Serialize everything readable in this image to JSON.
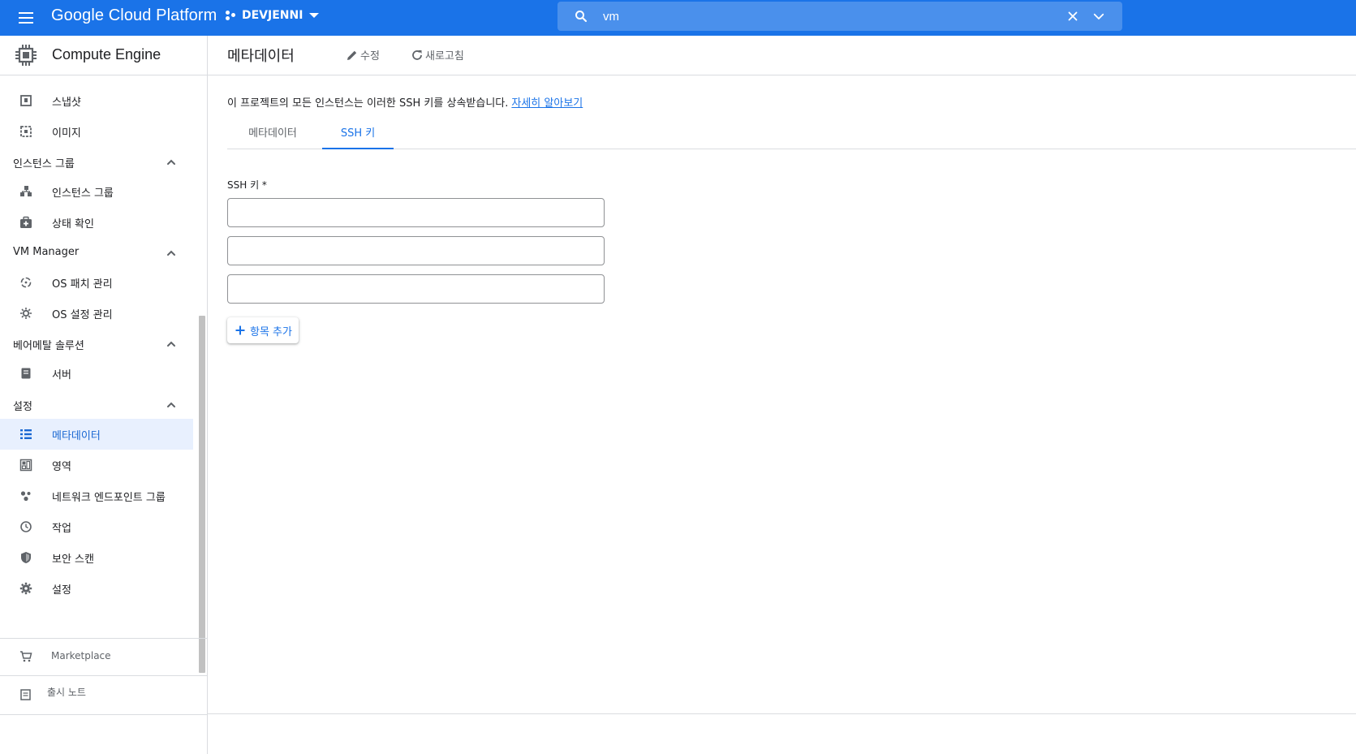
{
  "app": {
    "brand": "Google Cloud Platform",
    "project": "DEVJENNI"
  },
  "search": {
    "value": "vm"
  },
  "sidebar": {
    "product": "Compute Engine",
    "items": [
      {
        "label": "스냅샷",
        "icon": "snapshot-icon"
      },
      {
        "label": "이미지",
        "icon": "image-icon"
      }
    ],
    "groups": {
      "instance_groups": {
        "label": "인스턴스 그룹",
        "items": [
          {
            "label": "인스턴스 그룹",
            "icon": "instance-groups-icon"
          },
          {
            "label": "상태 확인",
            "icon": "health-check-icon"
          }
        ]
      },
      "vm_manager": {
        "label": "VM Manager",
        "items": [
          {
            "label": "OS 패치 관리",
            "icon": "os-patch-icon"
          },
          {
            "label": "OS 설정 관리",
            "icon": "os-config-icon"
          }
        ]
      },
      "bare_metal": {
        "label": "베어메탈 솔루션",
        "items": [
          {
            "label": "서버",
            "icon": "server-icon"
          }
        ]
      },
      "settings": {
        "label": "설정",
        "items": [
          {
            "label": "메타데이터",
            "icon": "metadata-icon",
            "active": true
          },
          {
            "label": "영역",
            "icon": "zones-icon"
          },
          {
            "label": "네트워크 엔드포인트 그룹",
            "icon": "network-endpoint-icon"
          },
          {
            "label": "작업",
            "icon": "operations-icon"
          },
          {
            "label": "보안 스캔",
            "icon": "security-scan-icon"
          },
          {
            "label": "설정",
            "icon": "settings-icon"
          }
        ]
      }
    },
    "marketplace": "Marketplace",
    "release_notes": "출시 노트"
  },
  "main": {
    "title": "메타데이터",
    "edit_label": "수정",
    "refresh_label": "새로고침",
    "info_text": "이 프로젝트의 모든 인스턴스는 이러한 SSH 키를 상속받습니다.",
    "info_link": "자세히 알아보기",
    "tabs": [
      {
        "label": "메타데이터"
      },
      {
        "label": "SSH 키",
        "active": true
      }
    ],
    "ssh_label": "SSH 키 *",
    "ssh_values": [
      "",
      "",
      ""
    ],
    "add_item_label": "항목 추가"
  },
  "colors": {
    "brand_blue": "#1a73e8",
    "active_bg": "#e8f0fe",
    "border": "#dadce0"
  }
}
